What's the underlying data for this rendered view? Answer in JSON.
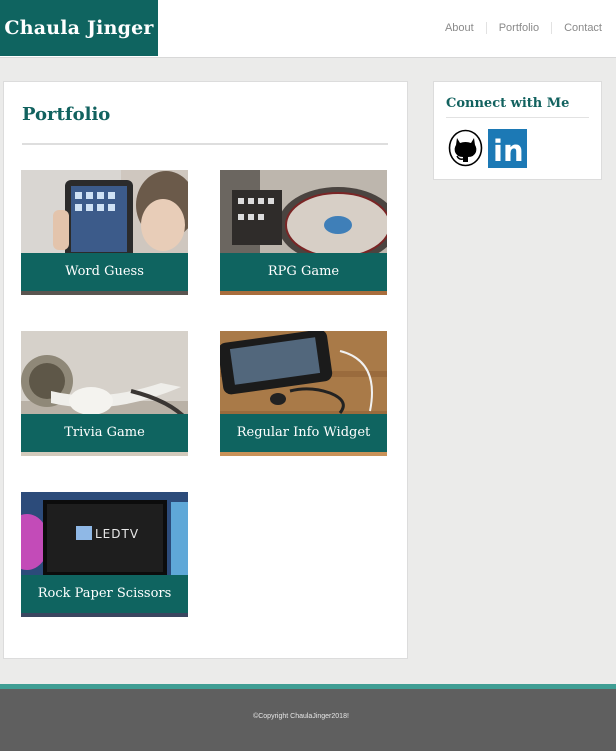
{
  "brand": {
    "name": "Chaula Jinger"
  },
  "nav": {
    "items": [
      "About",
      "Portfolio",
      "Contact"
    ]
  },
  "portfolio": {
    "title": "Portfolio",
    "projects": [
      {
        "label": "Word Guess",
        "image": "tablet-photo"
      },
      {
        "label": "RPG Game",
        "image": "turntable-photo"
      },
      {
        "label": "Trivia Game",
        "image": "earbuds-photo"
      },
      {
        "label": "Regular Info Widget",
        "image": "phone-headphones-photo"
      },
      {
        "label": "Rock Paper Scissors",
        "image": "led-tv-photo"
      }
    ]
  },
  "connect": {
    "title": "Connect with Me",
    "links": [
      {
        "icon": "github-icon"
      },
      {
        "icon": "linkedin-icon",
        "glyph": "in"
      }
    ]
  },
  "footer": {
    "copyright": "©Copyright ChaulaJinger2018!"
  },
  "colors": {
    "accent": "#0f6460",
    "footer_strip": "#3f9e94",
    "footer": "#5f5f5f"
  }
}
